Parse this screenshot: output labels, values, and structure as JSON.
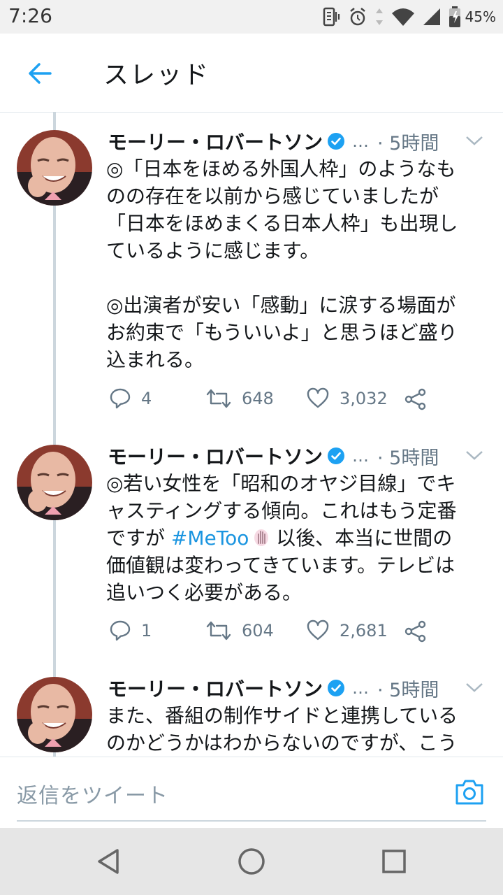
{
  "status_bar": {
    "time": "7:26",
    "battery": "45%"
  },
  "header": {
    "title": "スレッド"
  },
  "tweets": [
    {
      "author": "モーリー・ロバートソン",
      "ellipsis": "…",
      "time": "· 5時間",
      "lines": [
        "◎「日本をほめる外国人枠」のようなも",
        "のの存在を以前から感じていましたが",
        "「日本をほめまくる日本人枠」も出現し",
        "ているように感じます。",
        "",
        "◎出演者が安い「感動」に涙する場面が",
        "お約束で「もういいよ」と思うほど盛り",
        "込まれる。"
      ],
      "replies": "4",
      "retweets": "648",
      "likes": "3,032"
    },
    {
      "author": "モーリー・ロバートソン",
      "ellipsis": "…",
      "time": "· 5時間",
      "line1": "◎若い女性を「昭和のオヤジ目線」でキ",
      "line2": "ャスティングする傾向。これはもう定番",
      "line3_pre": "ですが ",
      "hashtag": "#MeToo",
      "line3_post": " 以後、本当に世間の",
      "line4": "価値観は変わってきています。テレビは",
      "line5": "追いつく必要がある。",
      "replies": "1",
      "retweets": "604",
      "likes": "2,681"
    },
    {
      "author": "モーリー・ロバートソン",
      "ellipsis": "…",
      "time": "· 5時間",
      "lines": [
        "また、番組の制作サイドと連携している",
        "のかどうかはわからないのですが、こう"
      ]
    }
  ],
  "reply_bar": {
    "placeholder": "返信をツイート"
  },
  "colors": {
    "accent": "#1da1f2",
    "hashtag": "#1b95e0",
    "muted": "#657786",
    "divider": "#e1e8ed"
  }
}
